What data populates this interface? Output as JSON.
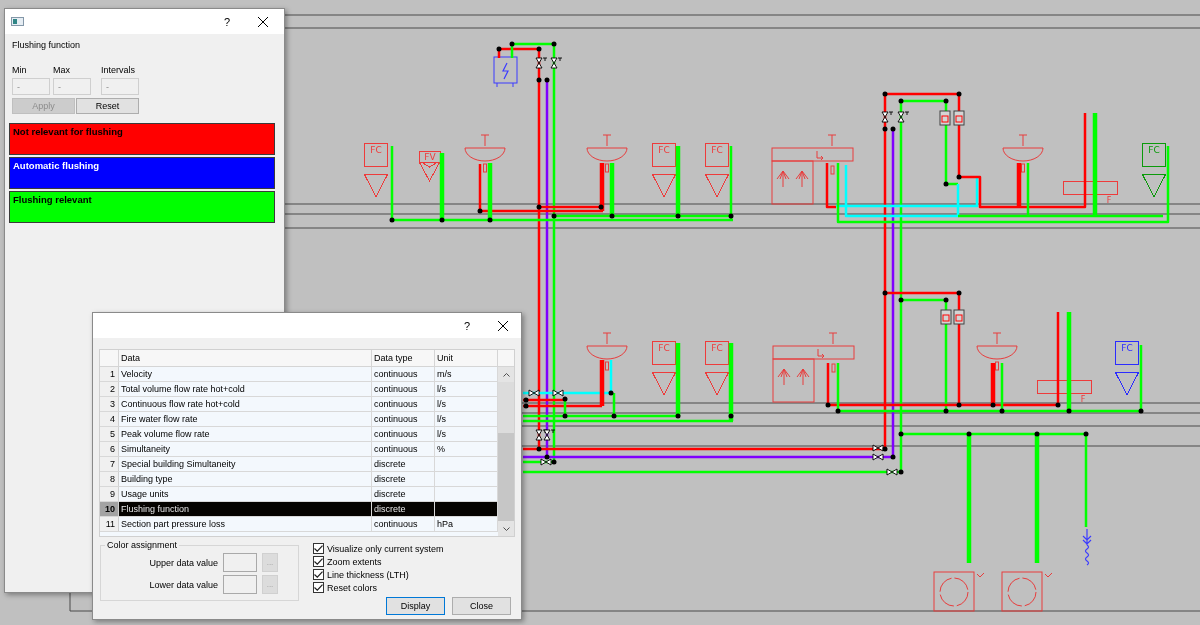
{
  "legend_window": {
    "help": "?",
    "heading": "Flushing function",
    "fields": [
      {
        "label": "Min",
        "value": "-",
        "disabled": true
      },
      {
        "label": "Max",
        "value": "-",
        "disabled": true
      },
      {
        "label": "Intervals",
        "value": "-",
        "disabled": true
      }
    ],
    "buttons": [
      {
        "label": "Apply",
        "disabled": true
      },
      {
        "label": "Reset",
        "disabled": false
      }
    ],
    "legend": [
      {
        "label": "Not relevant for flushing",
        "color": "#ff0000"
      },
      {
        "label": "Automatic flushing",
        "color": "#0000ff"
      },
      {
        "label": "Flushing relevant",
        "color": "#00ff00"
      }
    ]
  },
  "drawing": {
    "fixtures": [
      {
        "kind": "square",
        "label": "FC",
        "color": "#ee3b3b"
      },
      {
        "kind": "flat",
        "label": "FV",
        "color": "#ee3b3b"
      },
      {
        "kind": "square",
        "label": "FC",
        "color": "#ee3b3b"
      },
      {
        "kind": "square",
        "label": "FC",
        "color": "#ee3b3b"
      },
      {
        "kind": "square",
        "label": "FC",
        "color": "#0a9a0a"
      },
      {
        "kind": "bar",
        "label": "F",
        "color": "#ee3b3b"
      },
      {
        "kind": "square",
        "label": "FC",
        "color": "#ee3b3b"
      },
      {
        "kind": "square",
        "label": "FC",
        "color": "#ee3b3b"
      },
      {
        "kind": "square",
        "label": "FC",
        "color": "#2b2bff"
      },
      {
        "kind": "bar",
        "label": "F",
        "color": "#ee3b3b"
      }
    ]
  },
  "data_window": {
    "help": "?",
    "table": {
      "columns": [
        "Data",
        "Data type",
        "Unit"
      ],
      "rows": [
        {
          "number": "1",
          "data": "Velocity",
          "data_type": "continuous",
          "unit": "m/s",
          "selected": false
        },
        {
          "number": "2",
          "data": "Total volume flow rate hot+cold",
          "data_type": "continuous",
          "unit": "l/s",
          "selected": false
        },
        {
          "number": "3",
          "data": "Continuous flow rate hot+cold",
          "data_type": "continuous",
          "unit": "l/s",
          "selected": false
        },
        {
          "number": "4",
          "data": "Fire water flow rate",
          "data_type": "continuous",
          "unit": "l/s",
          "selected": false
        },
        {
          "number": "5",
          "data": "Peak volume flow rate",
          "data_type": "continuous",
          "unit": "l/s",
          "selected": false
        },
        {
          "number": "6",
          "data": "Simultaneity",
          "data_type": "continuous",
          "unit": "%",
          "selected": false
        },
        {
          "number": "7",
          "data": "Special building Simultaneity",
          "data_type": "discrete",
          "selected": false
        },
        {
          "number": "8",
          "data": "Building type",
          "data_type": "discrete",
          "selected": false
        },
        {
          "number": "9",
          "data": "Usage units",
          "data_type": "discrete",
          "selected": false
        },
        {
          "number": "10",
          "data": "Flushing function",
          "data_type": "discrete",
          "selected": true
        },
        {
          "number": "11",
          "data": "Section part pressure loss",
          "data_type": "continuous",
          "unit": "hPa",
          "selected": false
        }
      ]
    },
    "color_assignment": {
      "title": "Color assignment",
      "fields": [
        {
          "label": "Upper data value",
          "button": "...",
          "disabled": true
        },
        {
          "label": "Lower data value",
          "button": "...",
          "disabled": true
        }
      ]
    },
    "options": [
      {
        "label": "Visualize only current system",
        "checked": true
      },
      {
        "label": "Zoom extents",
        "checked": true
      },
      {
        "label": "Line thickness (LTH)",
        "checked": true
      },
      {
        "label": "Reset colors",
        "checked": true
      }
    ],
    "buttons": [
      {
        "label": "Display",
        "default": true
      },
      {
        "label": "Close",
        "default": false
      }
    ]
  }
}
